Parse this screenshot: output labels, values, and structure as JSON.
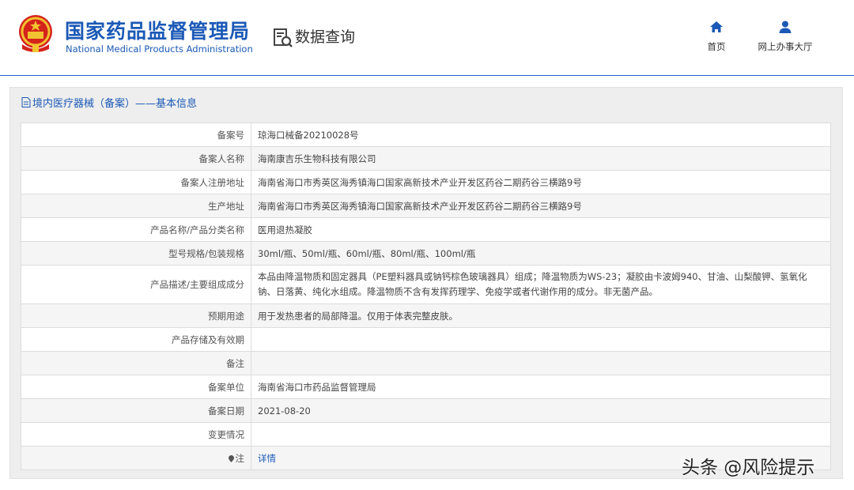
{
  "header": {
    "org_name_cn": "国家药品监督管理局",
    "org_name_en": "National Medical Products Administration",
    "section_title": "数据查询",
    "nav": [
      {
        "label": "首页",
        "icon": "home-icon"
      },
      {
        "label": "网上办事大厅",
        "icon": "user-icon"
      }
    ]
  },
  "panel": {
    "title": "境内医疗器械（备案）——基本信息"
  },
  "record": {
    "rows": [
      {
        "key": "备案号",
        "value": "琼海口械备20210028号"
      },
      {
        "key": "备案人名称",
        "value": "海南康吉乐生物科技有限公司"
      },
      {
        "key": "备案人注册地址",
        "value": "海南省海口市秀英区海秀镇海口国家高新技术产业开发区药谷二期药谷三横路9号"
      },
      {
        "key": "生产地址",
        "value": "海南省海口市秀英区海秀镇海口国家高新技术产业开发区药谷二期药谷三横路9号"
      },
      {
        "key": "产品名称/产品分类名称",
        "value": "医用退热凝胶"
      },
      {
        "key": "型号规格/包装规格",
        "value": "30ml/瓶、50ml/瓶、60ml/瓶、80ml/瓶、100ml/瓶"
      },
      {
        "key": "产品描述/主要组成成分",
        "value": "本品由降温物质和固定器具（PE塑料器具或钠钙棕色玻璃器具）组成；降温物质为WS-23；凝胶由卡波姆940、甘油、山梨酸钾、氢氧化钠、日落黄、纯化水组成。降温物质不含有发挥药理学、免疫学或者代谢作用的成分。非无菌产品。"
      },
      {
        "key": "预期用途",
        "value": "用于发热患者的局部降温。仅用于体表完整皮肤。"
      },
      {
        "key": "产品存储及有效期",
        "value": ""
      },
      {
        "key": "备注",
        "value": ""
      },
      {
        "key": "备案单位",
        "value": "海南省海口市药品监督管理局"
      },
      {
        "key": "备案日期",
        "value": "2021-08-20"
      },
      {
        "key": "变更情况",
        "value": ""
      },
      {
        "key": "注",
        "value": "详情"
      }
    ]
  },
  "watermark": "头条 @风险提示",
  "colors": {
    "brand_blue": "#1b59b6",
    "panel_bg": "#eeeeee",
    "row_stripe": "#f5f5f5"
  }
}
